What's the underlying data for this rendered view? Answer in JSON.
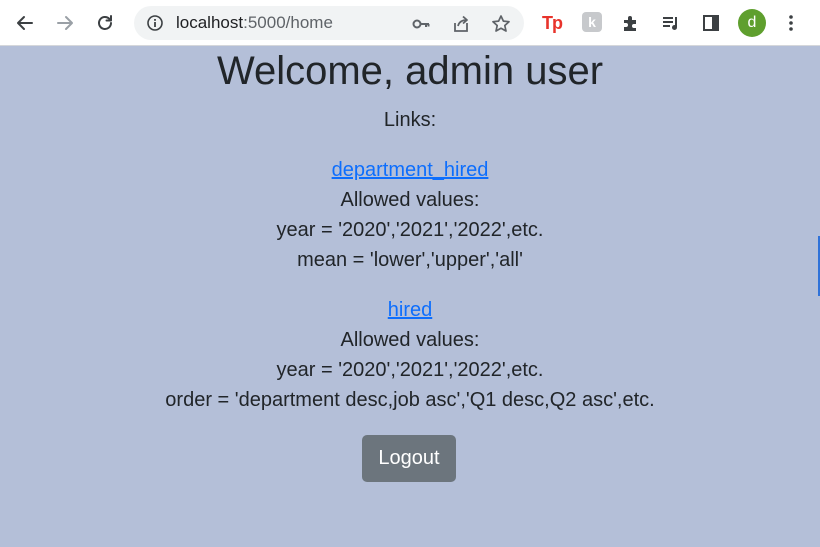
{
  "browser": {
    "url_host": "localhost",
    "url_rest": ":5000/home",
    "extensions": {
      "tp_label": "Tp",
      "k_label": "k"
    },
    "avatar_letter": "d",
    "icons": [
      "back-arrow-icon",
      "forward-arrow-icon",
      "reload-icon",
      "site-info-icon",
      "key-icon",
      "share-icon",
      "star-icon",
      "puzzle-icon",
      "media-queue-icon",
      "side-panel-icon",
      "kebab-menu-icon"
    ]
  },
  "page": {
    "title": "Welcome, admin user",
    "links_heading": "Links:",
    "sections": [
      {
        "link_text": "department_hired",
        "allowed_label": "Allowed values:",
        "param1": "year = '2020','2021','2022',etc.",
        "param2": "mean = 'lower','upper','all'"
      },
      {
        "link_text": "hired",
        "allowed_label": "Allowed values:",
        "param1": "year = '2020','2021','2022',etc.",
        "param2": "order = 'department desc,job asc','Q1 desc,Q2 asc',etc."
      }
    ],
    "logout_label": "Logout"
  },
  "colors": {
    "page_background": "#b4bfd8",
    "link": "#0d6efd",
    "logout_button": "#6c757d",
    "avatar": "#5f9f2e"
  }
}
